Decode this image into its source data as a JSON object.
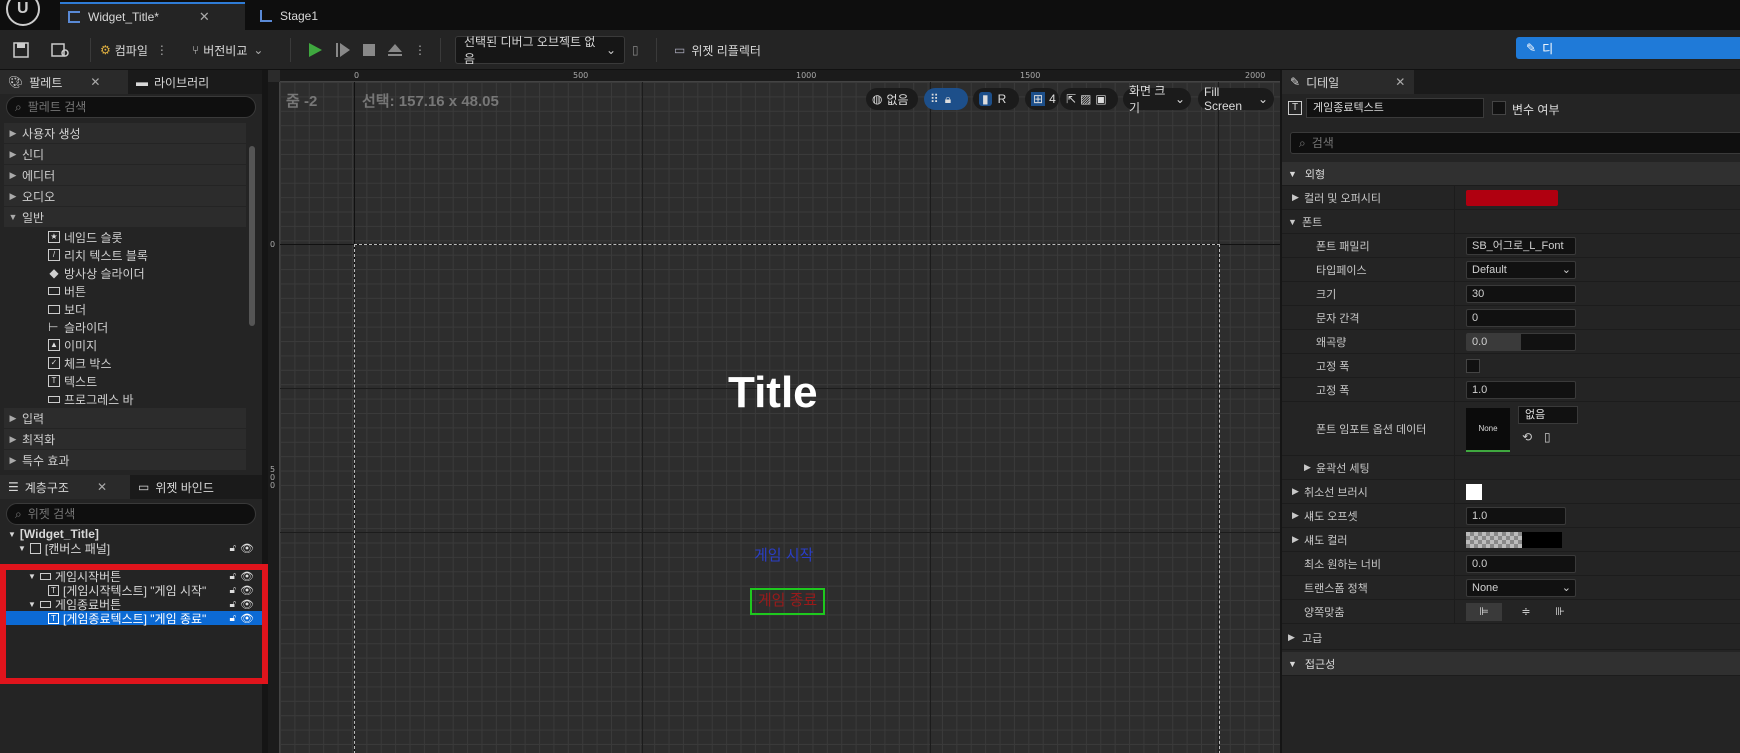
{
  "tabs": [
    {
      "label": "Widget_Title*",
      "active": true
    },
    {
      "label": "Stage1",
      "active": false
    }
  ],
  "toolbar": {
    "compile_label": "컴파일",
    "diff_label": "버전비교",
    "debug_select": "선택된 디버그 오브젝트 없음",
    "reflector_label": "위젯 리플렉터",
    "details_button": "디"
  },
  "palette": {
    "tab_label": "팔레트",
    "library_tab": "라이브러리",
    "search_placeholder": "팔레트 검색",
    "categories_top": [
      "사용자 생성",
      "신디",
      "에디터",
      "오디오"
    ],
    "open_category": "일반",
    "items": [
      "네임드 슬롯",
      "리치 텍스트 블록",
      "방사상 슬라이더",
      "버튼",
      "보더",
      "슬라이더",
      "이미지",
      "체크 박스",
      "텍스트",
      "프로그레스 바"
    ],
    "categories_bottom": [
      "입력",
      "최적화",
      "특수 효과"
    ]
  },
  "hierarchy": {
    "tab_label": "계층구조",
    "binding_tab": "위젯 바인드",
    "search_placeholder": "위젯 검색",
    "rows": [
      "[Widget_Title]",
      "[캔버스 패널]",
      "게임시작버튼",
      "[게임시작텍스트] \"게임 시작\"",
      "게임종료버튼",
      "[게임종료텍스트] \"게임 종료\""
    ]
  },
  "viewport": {
    "zoom_label": "줌 -2",
    "selection_label": "선택: 157.16 x 48.05",
    "ruler_top": [
      "0",
      "500",
      "1000",
      "1500",
      "2000"
    ],
    "ruler_left": [
      "0",
      "5\n0\n0"
    ],
    "none_label": "없음",
    "r_label": "R",
    "grid_count": "4",
    "screen_size": "화면 크기",
    "fill_screen": "Fill Screen",
    "title_text": "Title",
    "start_text": "게임 시작",
    "end_text": "게임 종료"
  },
  "details": {
    "tab_label": "디테일",
    "name_value": "게임종료텍스트",
    "is_variable": "변수 여부",
    "search_placeholder": "검색",
    "sections": {
      "appearance": "외형",
      "color_opacity": "컬러 및 오퍼시티",
      "font": "폰트",
      "font_family": "폰트 패밀리",
      "typeface": "타입페이스",
      "size": "크기",
      "letter_spacing": "문자 간격",
      "skew": "왜곡량",
      "fixed_width1": "고정 폭",
      "fixed_width2": "고정 폭",
      "font_import": "폰트 임포트 옵션 데이터",
      "outline": "윤곽선 세팅",
      "strike_brush": "취소선 브러시",
      "shadow_offset": "섀도 오프셋",
      "shadow_color": "섀도 컬러",
      "min_width": "최소 원하는 너비",
      "transform_policy": "트랜스폼 정책",
      "justification": "양쪽맞춤",
      "advanced": "고급",
      "accessibility": "접근성"
    },
    "values": {
      "font_family": "SB_어그로_L_Font",
      "typeface": "Default",
      "size": "30",
      "letter_spacing": "0",
      "skew": "0.0",
      "fixed_width": "1.0",
      "font_import_thumb": "None",
      "font_import_value": "없음",
      "shadow_offset": "1.0",
      "min_width": "0.0",
      "transform_policy": "None"
    },
    "color_swatch": "#b00010"
  },
  "colors": {
    "accent": "#1f7ad8",
    "selection": "#0c6ad4",
    "highlight_box": "#e0141c",
    "end_border": "#1ec81e",
    "start_text": "#2a3ec8",
    "end_text": "#9a1a1a"
  }
}
